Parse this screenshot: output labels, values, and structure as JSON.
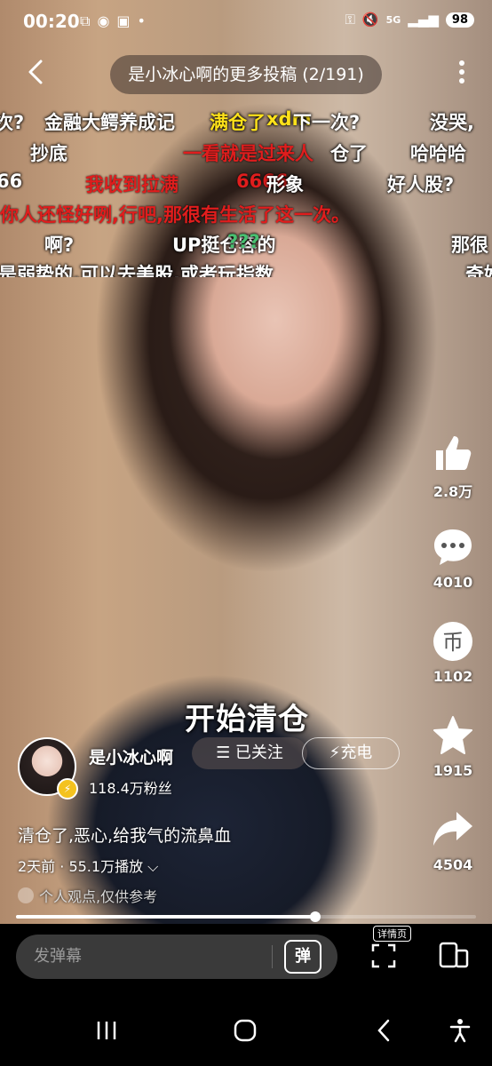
{
  "status": {
    "time": "00:20",
    "battery": "98",
    "network": "5G"
  },
  "header": {
    "title": "是小冰心啊的更多投稿 (2/191)"
  },
  "danmaku": [
    "次?",
    "金融大鳄养成记",
    "满仓了",
    "xdm",
    "下一次?",
    "没哭,",
    "抄底",
    "一看就是过来人",
    "仓了",
    "哈哈哈",
    "66",
    "我收到拉满",
    "6666",
    "形象",
    "好人股?",
    "你人还怪好咧,行吧,那很有生活了这一次。",
    "啊?",
    "UP挺仓容的",
    "???",
    "那很",
    "是弱势的,可以去美股,或者玩指数",
    "奇好"
  ],
  "actions": {
    "like": "2.8万",
    "comment": "4010",
    "coin": "1102",
    "favorite": "1915",
    "share": "4504"
  },
  "overlay_caption": "开始清仓",
  "author": {
    "name": "是小冰心啊",
    "fans": "118.4万粉丝",
    "follow_label": "已关注",
    "charge_label": "充电"
  },
  "video": {
    "title": "清仓了,恶心,给我气的流鼻血",
    "meta": "2天前 · 55.1万播放",
    "notice": "个人观点,仅供参考",
    "progress": 0.65
  },
  "bottom": {
    "danmu_placeholder": "发弹幕",
    "danmu_switch": "弹",
    "detail_label": "详情页"
  },
  "colors": {
    "accent": "#fb7299",
    "danmaku_red": "#e01d1d",
    "danmaku_yellow": "#ffe21a"
  }
}
